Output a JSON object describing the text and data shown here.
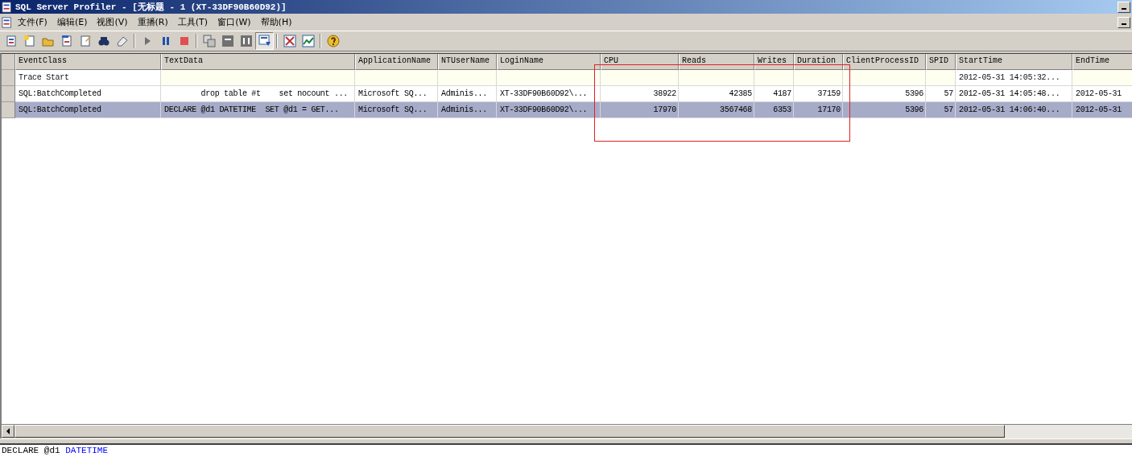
{
  "window": {
    "title": "SQL Server Profiler - [无标题 - 1 (XT-33DF90B60D92)]"
  },
  "menu": [
    "文件(F)",
    "编辑(E)",
    "视图(V)",
    "重播(R)",
    "工具(T)",
    "窗口(W)",
    "帮助(H)"
  ],
  "toolbar": [
    {
      "buttons": [
        {
          "pressed": false
        },
        {
          "pressed": false
        },
        {
          "pressed": false
        },
        {
          "pressed": false
        },
        {
          "pressed": false
        },
        {
          "pressed": false
        },
        {
          "pressed": false
        }
      ]
    },
    {
      "buttons": [
        {
          "pressed": false
        },
        {
          "pressed": false
        },
        {
          "pressed": false
        }
      ]
    },
    {
      "buttons": [
        {
          "pressed": false
        },
        {
          "pressed": false
        },
        {
          "pressed": false
        },
        {
          "pressed": true
        }
      ]
    },
    {
      "buttons": [
        {
          "pressed": false
        },
        {
          "pressed": false
        }
      ]
    },
    {
      "buttons": [
        {
          "pressed": false
        }
      ]
    }
  ],
  "table": {
    "columns": [
      {
        "name": "EventClass",
        "numeric": false
      },
      {
        "name": "TextData",
        "numeric": false
      },
      {
        "name": "ApplicationName",
        "numeric": false
      },
      {
        "name": "NTUserName",
        "numeric": false
      },
      {
        "name": "LoginName",
        "numeric": false
      },
      {
        "name": "CPU",
        "numeric": true
      },
      {
        "name": "Reads",
        "numeric": true
      },
      {
        "name": "Writes",
        "numeric": true
      },
      {
        "name": "Duration",
        "numeric": true
      },
      {
        "name": "ClientProcessID",
        "numeric": true
      },
      {
        "name": "SPID",
        "numeric": true
      },
      {
        "name": "StartTime",
        "numeric": false
      },
      {
        "name": "EndTime",
        "numeric": false
      }
    ],
    "rows": [
      {
        "kind": "trace",
        "selected": false,
        "cells": [
          "Trace Start",
          null,
          null,
          null,
          null,
          null,
          null,
          null,
          null,
          null,
          null,
          "2012-05-31 14:05:32...",
          null
        ]
      },
      {
        "kind": "event",
        "selected": false,
        "cells": [
          "SQL:BatchCompleted",
          "        drop table #t    set nocount ...",
          "Microsoft SQ...",
          "Adminis...",
          "XT-33DF90B60D92\\...",
          "38922",
          "42385",
          "4187",
          "37159",
          "5396",
          "57",
          "2012-05-31 14:05:48...",
          "2012-05-31"
        ]
      },
      {
        "kind": "event",
        "selected": true,
        "cells": [
          "SQL:BatchCompleted",
          "DECLARE @d1 DATETIME  SET @d1 = GET...",
          "Microsoft SQ...",
          "Adminis...",
          "XT-33DF90B60D92\\...",
          "17970",
          "3567468",
          "6353",
          "17170",
          "5396",
          "57",
          "2012-05-31 14:06:40...",
          "2012-05-31"
        ]
      }
    ]
  },
  "detail": [
    {
      "text": "DECLARE @d1",
      "kind": "plain"
    },
    {
      "text": "DATETIME",
      "kind": "keyword"
    }
  ]
}
